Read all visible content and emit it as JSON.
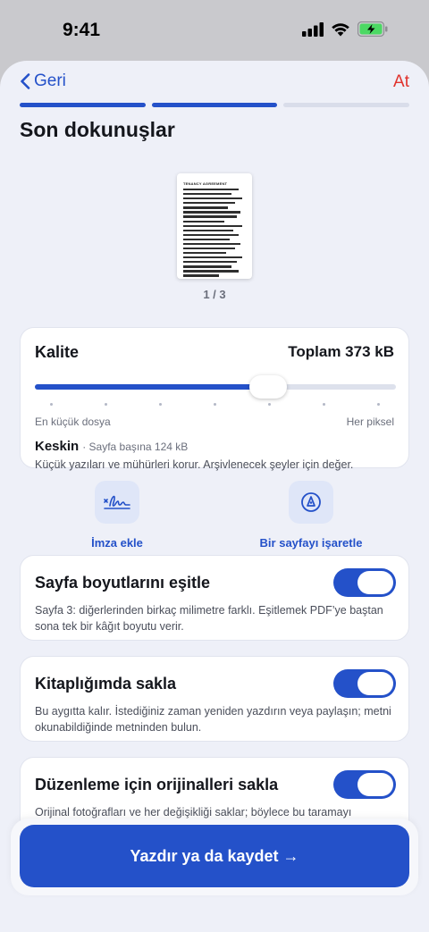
{
  "status": {
    "time": "9:41"
  },
  "nav": {
    "back_label": "Geri",
    "skip_label": "At",
    "steps": 3,
    "current_step": 2
  },
  "page": {
    "title": "Son dokunuşlar"
  },
  "preview": {
    "doc_title": "TENANCY AGREEMENT",
    "page_counter": "1 / 3"
  },
  "quality": {
    "label": "Kalite",
    "total": "Toplam 373 kB",
    "level_fraction": 0.645,
    "scale_min": "En küçük dosya",
    "scale_max": "Her piksel",
    "name": "Keskin",
    "per_page": "· Sayfa başına 124 kB",
    "description": "Küçük yazıları ve mühürleri korur. Arşivlenecek şeyler için değer."
  },
  "actions": [
    {
      "label": "İmza ekle",
      "icon": "signature-icon"
    },
    {
      "label": "Bir sayfayı işaretle",
      "icon": "pen-nib-icon"
    }
  ],
  "options": [
    {
      "title": "Sayfa boyutlarını eşitle",
      "description": "Sayfa 3: diğerlerinden birkaç milimetre farklı. Eşitlemek PDF’ye baştan sona tek bir kâğıt boyutu verir.",
      "enabled": true
    },
    {
      "title": "Kitaplığımda sakla",
      "description": "Bu aygıtta kalır. İstediğiniz zaman yeniden yazdırın veya paylaşın; metni okunabildiğinde metninden bulun.",
      "enabled": true
    },
    {
      "title": "Düzenleme için orijinalleri sakla",
      "description": "Orijinal fotoğrafları ve her değişikliği saklar; böylece bu taramayı",
      "enabled": true
    }
  ],
  "cta": {
    "label": "Yazdır ya da kaydet →"
  },
  "colors": {
    "accent": "#2451c9",
    "skip": "#e0332d",
    "battery": "#4cd964"
  }
}
